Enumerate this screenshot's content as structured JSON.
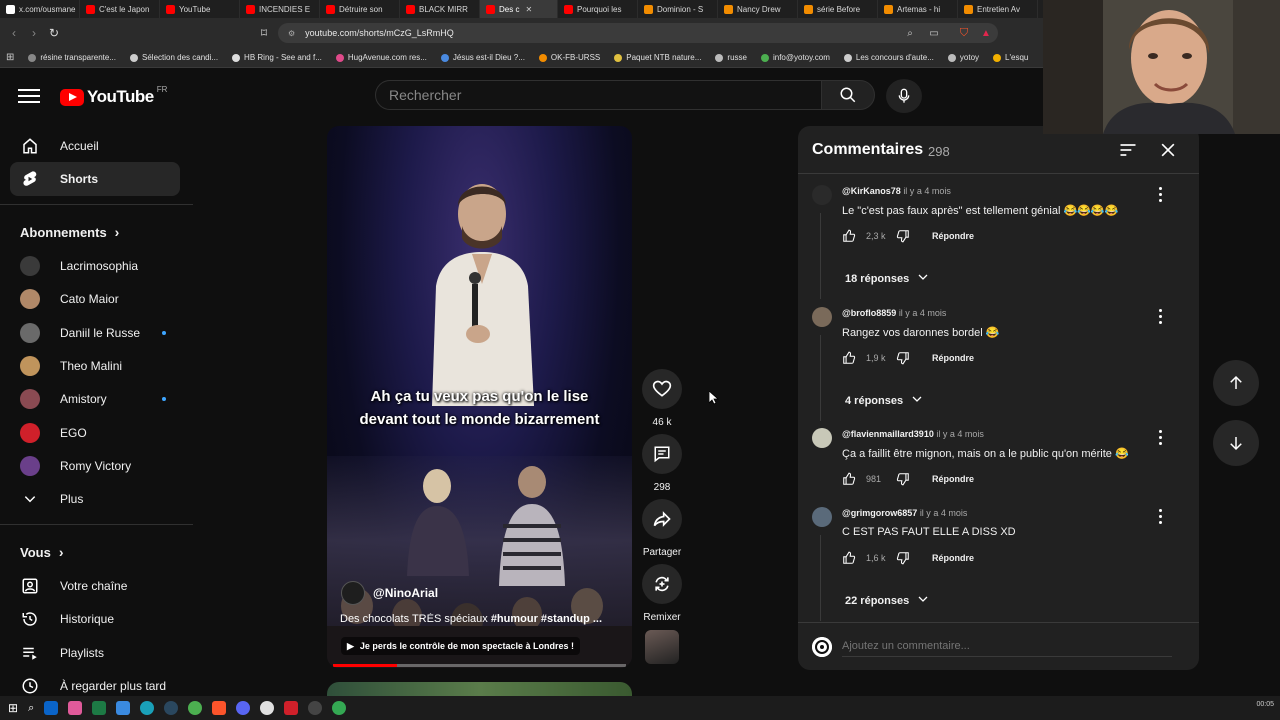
{
  "browser": {
    "tabs": [
      {
        "label": "x.com/ousmane",
        "color": "#ffffff",
        "active": false
      },
      {
        "label": "C'est le Japon",
        "color": "#ff0000",
        "active": false
      },
      {
        "label": "YouTube",
        "color": "#ff0000",
        "active": false
      },
      {
        "label": "INCENDIES E",
        "color": "#ff0000",
        "active": false
      },
      {
        "label": "Détruire son",
        "color": "#ff0000",
        "active": false
      },
      {
        "label": "BLACK MIRR",
        "color": "#ff0000",
        "active": false
      },
      {
        "label": "Des c",
        "color": "#ff0000",
        "active": true
      },
      {
        "label": "Pourquoi les",
        "color": "#ff0000",
        "active": false
      },
      {
        "label": "Dominion - S",
        "color": "#f28c00",
        "active": false
      },
      {
        "label": "Nancy Drew",
        "color": "#f28c00",
        "active": false
      },
      {
        "label": "série Before",
        "color": "#f28c00",
        "active": false
      },
      {
        "label": "Artemas - hi",
        "color": "#f28c00",
        "active": false
      },
      {
        "label": "Entretien Av",
        "color": "#f28c00",
        "active": false
      }
    ],
    "url": "youtube.com/shorts/mCzG_LsRmHQ",
    "bookmarks": [
      "résine transparente...",
      "Sélection des candi...",
      "HB Ring - See and f...",
      "HugAvenue.com res...",
      "Jésus est-il Dieu ?...",
      "OK-FB-URSS",
      "Paquet NTB nature...",
      "russe",
      "info@yotoy.com",
      "Les concours d'aute...",
      "yotoy",
      "L'esqu"
    ]
  },
  "header": {
    "logo_text": "YouTube",
    "country": "FR",
    "search_placeholder": "Rechercher"
  },
  "sidebar": {
    "main": [
      {
        "label": "Accueil",
        "icon": "home-icon"
      },
      {
        "label": "Shorts",
        "icon": "shorts-icon"
      }
    ],
    "subscriptions_heading": "Abonnements",
    "subscriptions": [
      {
        "label": "Lacrimosophia",
        "color": "#3a3a3a",
        "new": false
      },
      {
        "label": "Cato Maior",
        "color": "#b08868",
        "new": false
      },
      {
        "label": "Daniil le Russe",
        "color": "#6a6a6a",
        "new": true
      },
      {
        "label": "Theo Malini",
        "color": "#c0945c",
        "new": false
      },
      {
        "label": "Amistory",
        "color": "#8a4a52",
        "new": true
      },
      {
        "label": "EGO",
        "color": "#d0202a",
        "new": false
      },
      {
        "label": "Romy Victory",
        "color": "#6a3f8a",
        "new": false
      }
    ],
    "more_label": "Plus",
    "you_heading": "Vous",
    "you_items": [
      {
        "label": "Votre chaîne",
        "icon": "channel-icon"
      },
      {
        "label": "Historique",
        "icon": "history-icon"
      },
      {
        "label": "Playlists",
        "icon": "playlists-icon"
      },
      {
        "label": "À regarder plus tard",
        "icon": "watch-later-icon"
      }
    ]
  },
  "video": {
    "caption_line1": "Ah ça tu veux pas qu'on le lise",
    "caption_line2": "devant tout le monde bizarrement",
    "channel": "@NinoArial",
    "title_plain": "Des chocolats TRÈS spéciaux ",
    "title_tags": "#humour #standup ...",
    "linked_video": "Je perds le contrôle de mon spectacle à Londres !",
    "progress": 0.22
  },
  "actions": {
    "likes": "46 k",
    "comments": "298",
    "share": "Partager",
    "remix": "Remixer"
  },
  "comments": {
    "title": "Commentaires",
    "count": "298",
    "reply_label": "Répondre",
    "input_placeholder": "Ajoutez un commentaire...",
    "items": [
      {
        "handle": "@KirKanos78",
        "time": "il y a 4 mois",
        "text": "Le \"c'est pas faux après\" est tellement génial 😂😂😂😂",
        "likes": "2,3 k",
        "replies": "18 réponses",
        "avatar_color": "#2a2a2a"
      },
      {
        "handle": "@broflo8859",
        "time": "il y a 4 mois",
        "text": "Rangez vos daronnes bordel 😂",
        "likes": "1,9 k",
        "replies": "4 réponses",
        "avatar_color": "#7a6a5a"
      },
      {
        "handle": "@flavienmaillard3910",
        "time": "il y a 4 mois",
        "text": "Ça a faillit être mignon, mais on a le public qu'on mérite 😂",
        "likes": "981",
        "replies": "",
        "avatar_color": "#c8c8b8"
      },
      {
        "handle": "@grimgorow6857",
        "time": "il y a 4 mois",
        "text": "C EST PAS FAUT ELLE A DISS XD",
        "likes": "1,6 k",
        "replies": "22 réponses",
        "avatar_color": "#5a6a7a"
      }
    ]
  },
  "taskbar": {
    "clock": "00:05"
  }
}
